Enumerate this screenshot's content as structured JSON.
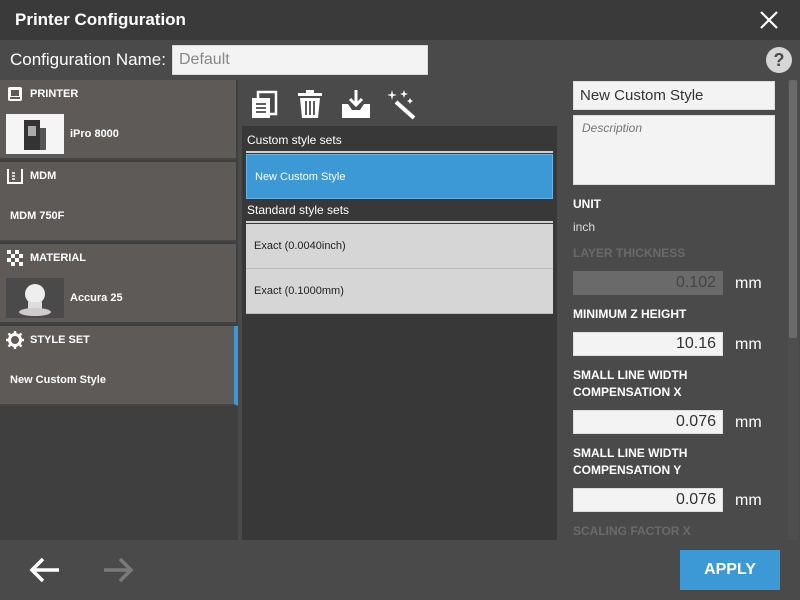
{
  "window": {
    "title": "Printer Configuration"
  },
  "config": {
    "label": "Configuration Name:",
    "value": "Default"
  },
  "help": {
    "label": "?"
  },
  "panels": {
    "printer": {
      "header": "PRINTER",
      "value": "iPro 8000"
    },
    "mdm": {
      "header": "MDM",
      "value": "MDM 750F"
    },
    "material": {
      "header": "MATERIAL",
      "value": "Accura 25"
    },
    "style_set": {
      "header": "STYLE SET",
      "value": "New Custom Style"
    }
  },
  "toolbar": {
    "icons": [
      "copy-icon",
      "trash-icon",
      "import-icon",
      "magic-wand-icon"
    ]
  },
  "style_list": {
    "custom_header": "Custom style sets",
    "custom_items": [
      "New Custom Style"
    ],
    "standard_header": "Standard style sets",
    "standard_items": [
      "Exact (0.0040inch)",
      "Exact (0.1000mm)"
    ]
  },
  "details": {
    "name": "New Custom Style",
    "description_placeholder": "Description",
    "unit_label": "UNIT",
    "unit_value": "inch",
    "layer_thickness_label": "LAYER THICKNESS",
    "layer_thickness_value": "0.102",
    "min_z_label": "MINIMUM Z HEIGHT",
    "min_z_value": "10.16",
    "slwc_x_label_1": "SMALL LINE WIDTH",
    "slwc_x_label_2": "COMPENSATION X",
    "slwc_x_value": "0.076",
    "slwc_y_label_1": "SMALL LINE WIDTH",
    "slwc_y_label_2": "COMPENSATION Y",
    "slwc_y_value": "0.076",
    "scaling_x_label": "SCALING FACTOR X",
    "mm": "mm"
  },
  "footer": {
    "apply_label": "APPLY"
  },
  "colors": {
    "accent": "#3d98d6",
    "panel": "#5d5a57",
    "background": "#4a4a4a"
  }
}
